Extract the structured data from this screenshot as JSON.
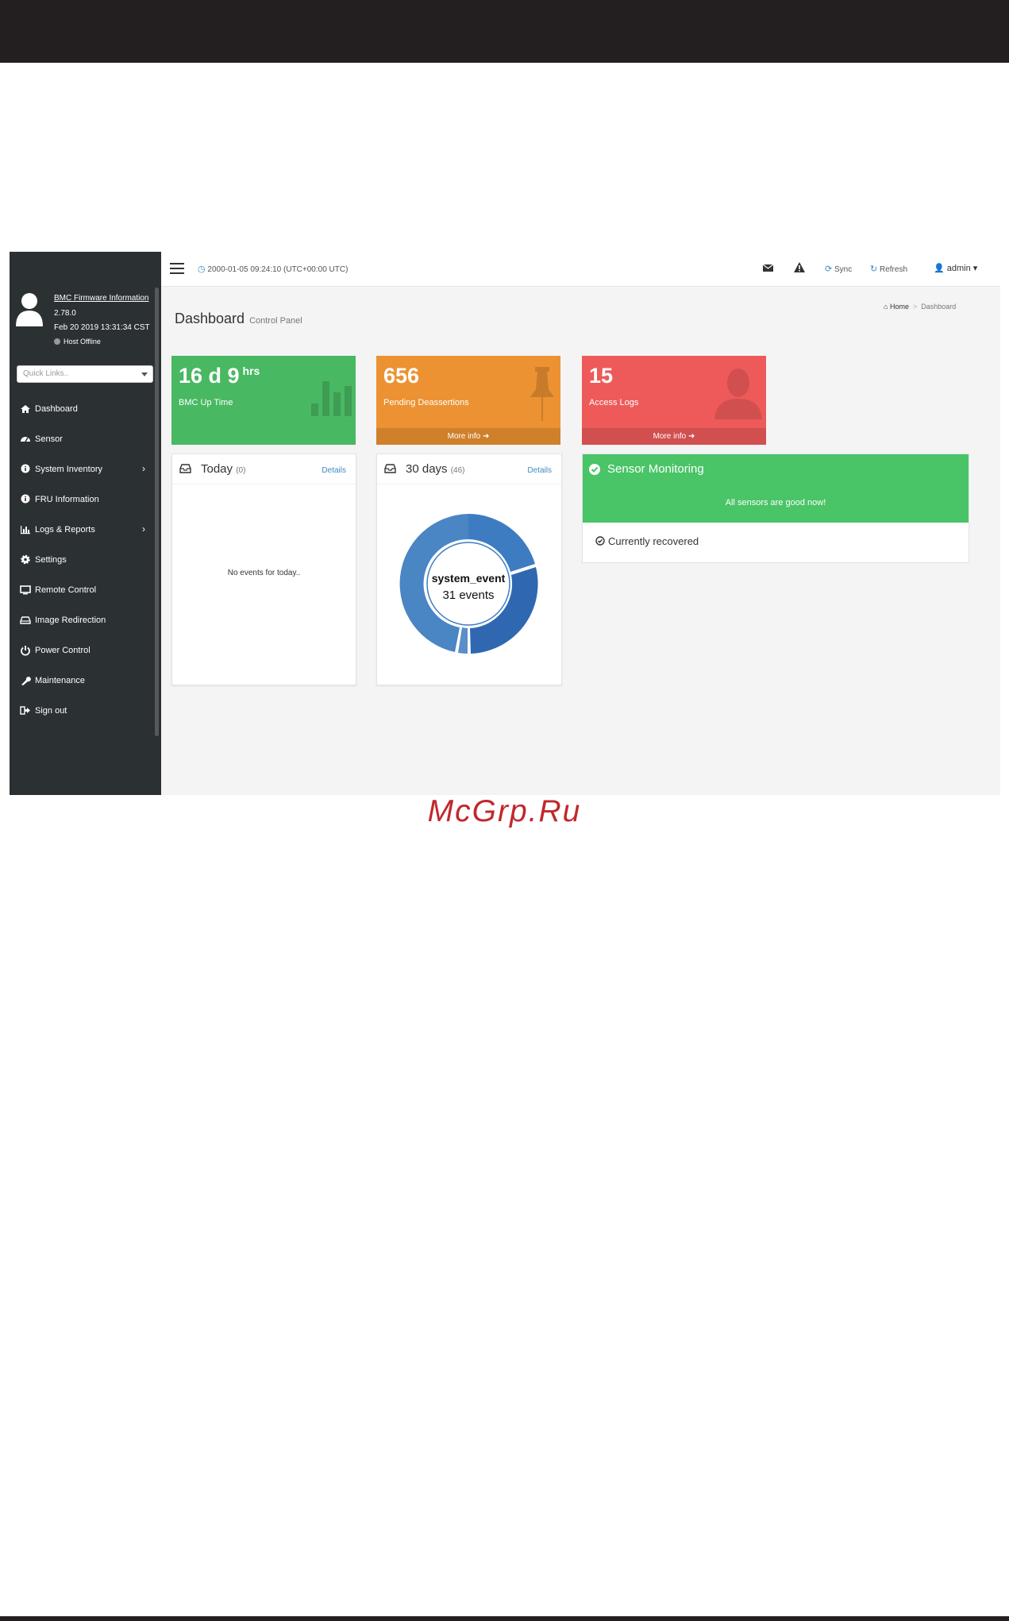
{
  "sidebar": {
    "firmware_link": "BMC Firmware Information",
    "firmware_version": "2.78.0",
    "firmware_date": "Feb 20 2019 13:31:34 CST",
    "host_status": "Host Offline",
    "quick_links_placeholder": "Quick Links..",
    "items": [
      {
        "label": "Dashboard",
        "icon": "dashboard-icon"
      },
      {
        "label": "Sensor",
        "icon": "gauge-icon"
      },
      {
        "label": "System Inventory",
        "icon": "info-icon",
        "has_submenu": true
      },
      {
        "label": "FRU Information",
        "icon": "info-icon"
      },
      {
        "label": "Logs & Reports",
        "icon": "bar-chart-icon",
        "has_submenu": true
      },
      {
        "label": "Settings",
        "icon": "gear-icon"
      },
      {
        "label": "Remote Control",
        "icon": "monitor-icon"
      },
      {
        "label": "Image Redirection",
        "icon": "drive-icon"
      },
      {
        "label": "Power Control",
        "icon": "power-icon"
      },
      {
        "label": "Maintenance",
        "icon": "wrench-icon"
      },
      {
        "label": "Sign out",
        "icon": "sign-out-icon"
      }
    ],
    "submenu_chevron": "›"
  },
  "navbar": {
    "datetime": "2000-01-05 09:24:10 (UTC+00:00 UTC)",
    "sync_label": "Sync",
    "refresh_label": "Refresh",
    "user_label": "admin"
  },
  "content": {
    "title": "Dashboard",
    "subtitle": "Control Panel",
    "breadcrumb_home": "Home",
    "breadcrumb_sep": ">",
    "breadcrumb_current": "Dashboard"
  },
  "stats": {
    "uptime": {
      "value": "16 d 9",
      "unit": "hrs",
      "label": "BMC Up Time",
      "color": "#49b862"
    },
    "deassertions": {
      "value": "656",
      "label": "Pending Deassertions",
      "more": "More info",
      "color": "#ec9232"
    },
    "access_logs": {
      "value": "15",
      "label": "Access Logs",
      "more": "More info",
      "color": "#ee5a5a"
    }
  },
  "panels": {
    "today": {
      "title": "Today",
      "count": "(0)",
      "details": "Details",
      "empty_text": "No events for today.."
    },
    "days": {
      "title": "30 days",
      "count": "(46)",
      "details": "Details",
      "center_title": "system_event",
      "center_sub": "31 events"
    }
  },
  "sensor_monitoring": {
    "title": "Sensor Monitoring",
    "message": "All sensors are good now!",
    "recovered": "Currently recovered",
    "color": "#49c466"
  },
  "watermark": "McGrp.Ru"
}
